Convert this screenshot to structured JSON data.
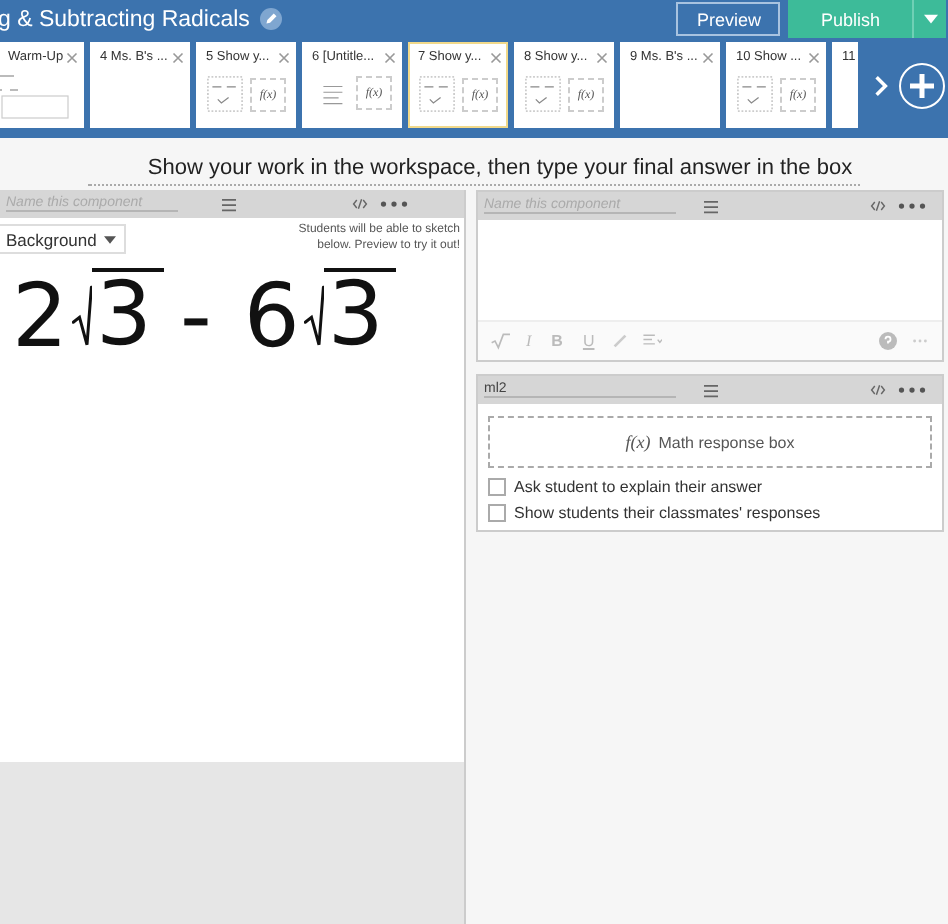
{
  "header": {
    "title": "g & Subtracting Radicals",
    "preview": "Preview",
    "publish": "Publish"
  },
  "slides": [
    {
      "label": "Warm-Up",
      "selected": false,
      "kind": "text"
    },
    {
      "label": "4 Ms. B's ...",
      "selected": false,
      "kind": "blank"
    },
    {
      "label": "5 Show y...",
      "selected": false,
      "kind": "sketch_math",
      "math_label": "f(x)"
    },
    {
      "label": "6 [Untitle...",
      "selected": false,
      "kind": "note_math",
      "math_label": "f(x)"
    },
    {
      "label": "7 Show y...",
      "selected": true,
      "kind": "sketch_math",
      "math_label": "f(x)"
    },
    {
      "label": "8 Show y...",
      "selected": false,
      "kind": "sketch_math",
      "math_label": "f(x)"
    },
    {
      "label": "9 Ms. B's ...",
      "selected": false,
      "kind": "blank"
    },
    {
      "label": "10 Show ...",
      "selected": false,
      "kind": "sketch_math",
      "math_label": "f(x)"
    },
    {
      "label": "11",
      "selected": false,
      "kind": "cut"
    }
  ],
  "instruction": "Show your work in the workspace, then type your final answer in the box",
  "sketch_panel": {
    "name_placeholder": "Name this component",
    "background_button": "Background",
    "hint": "Students will be able to sketch below. Preview to try it out!",
    "ink": {
      "terms": [
        {
          "coefficient": "2",
          "radicand": "3"
        },
        {
          "coefficient": "6",
          "radicand": "3"
        }
      ],
      "operator": "-"
    }
  },
  "text_panel": {
    "name_placeholder": "Name this component",
    "toolbar": [
      "I",
      "B",
      "U"
    ]
  },
  "math_panel": {
    "name": "ml2",
    "fx": "f(x)",
    "response_box": "Math response box",
    "options": [
      {
        "label": "Ask student to explain their answer",
        "checked": false
      },
      {
        "label": "Show students their classmates' responses",
        "checked": false
      }
    ]
  }
}
